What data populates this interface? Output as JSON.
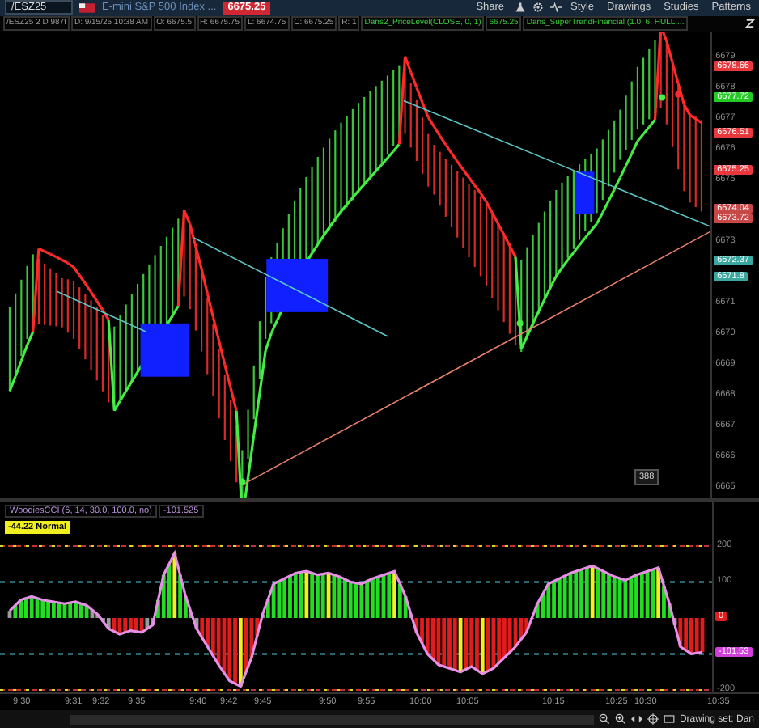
{
  "toolbar": {
    "symbol": "/ESZ25",
    "description": "E-mini S&P 500 Index ...",
    "last_price": "6675.25",
    "buttons": [
      {
        "label": "Share"
      },
      {
        "label": "Style"
      },
      {
        "label": "Drawings"
      },
      {
        "label": "Studies"
      },
      {
        "label": "Patterns"
      }
    ]
  },
  "info_bar": [
    {
      "kind": "plain",
      "text": "/ESZ25 2 D 987t"
    },
    {
      "kind": "plain",
      "text": "D: 9/15/25 10:38 AM"
    },
    {
      "kind": "plain",
      "text": "O: 6675.5"
    },
    {
      "kind": "plain",
      "text": "H: 6675.75"
    },
    {
      "kind": "plain",
      "text": "L: 6674.75"
    },
    {
      "kind": "plain",
      "text": "C: 6675.25"
    },
    {
      "kind": "plain",
      "text": "R: 1"
    },
    {
      "kind": "study",
      "text": "Dans2_PriceLevel(CLOSE, 0, 1)"
    },
    {
      "kind": "study",
      "text": "6675.25"
    },
    {
      "kind": "study",
      "text": "Dans_SuperTrendFinancial (1.0, 6, HULL,..."
    }
  ],
  "price_axis": {
    "ticks": [
      "6679",
      "6678",
      "6677",
      "6676",
      "6675",
      "6673",
      "6671",
      "6670",
      "6669",
      "6668",
      "6667",
      "6666",
      "6665"
    ],
    "badges": [
      {
        "text": "6678.66",
        "color": "#e8383d"
      },
      {
        "text": "6677.72",
        "color": "#22cc22"
      },
      {
        "text": "6676.51",
        "color": "#e8383d"
      },
      {
        "text": "6675.25",
        "color": "#e8383d"
      },
      {
        "text": "6674.04",
        "color": "#c84848"
      },
      {
        "text": "6673.72",
        "color": "#c84848"
      },
      {
        "text": "6672.37",
        "color": "#3aa8a0"
      },
      {
        "text": "6671.8",
        "color": "#3aa8a0"
      }
    ]
  },
  "bar_counter": "388",
  "oscillator": {
    "title": "WoodiesCCI (6, 14, 30.0, 100.0, no)",
    "reading": "-101.525",
    "status": "-44.22 Normal",
    "chart_data": {
      "type": "line",
      "ylim": [
        -207,
        324
      ],
      "yticks": [
        200,
        100,
        -200
      ],
      "series": [
        {
          "color": "#e890e8",
          "values": [
            20,
            50,
            60,
            50,
            45,
            40,
            45,
            35,
            10,
            -30,
            -45,
            -35,
            -40,
            -20,
            120,
            180,
            60,
            -30,
            -80,
            -130,
            -175,
            -190,
            -110,
            10,
            95,
            110,
            125,
            130,
            120,
            125,
            115,
            100,
            95,
            110,
            120,
            130,
            60,
            -40,
            -100,
            -130,
            -140,
            -150,
            -135,
            -155,
            -140,
            -110,
            -80,
            -40,
            40,
            95,
            110,
            125,
            135,
            145,
            130,
            115,
            105,
            120,
            130,
            140,
            40,
            -80,
            -100,
            -95
          ]
        }
      ]
    },
    "badges": [
      {
        "text": "0",
        "color": "#e02020"
      },
      {
        "text": "-101.53",
        "color": "#d040d8"
      }
    ]
  },
  "time_axis": [
    "9:30",
    "9:31",
    "9:32",
    "9:35",
    "9:40",
    "9:42",
    "9:45",
    "9:50",
    "9:55",
    "10:00",
    "10:05",
    "10:15",
    "10:25",
    "10:30",
    "10:35"
  ],
  "status_bar": {
    "drawing_set": "Drawing set: Dan"
  }
}
